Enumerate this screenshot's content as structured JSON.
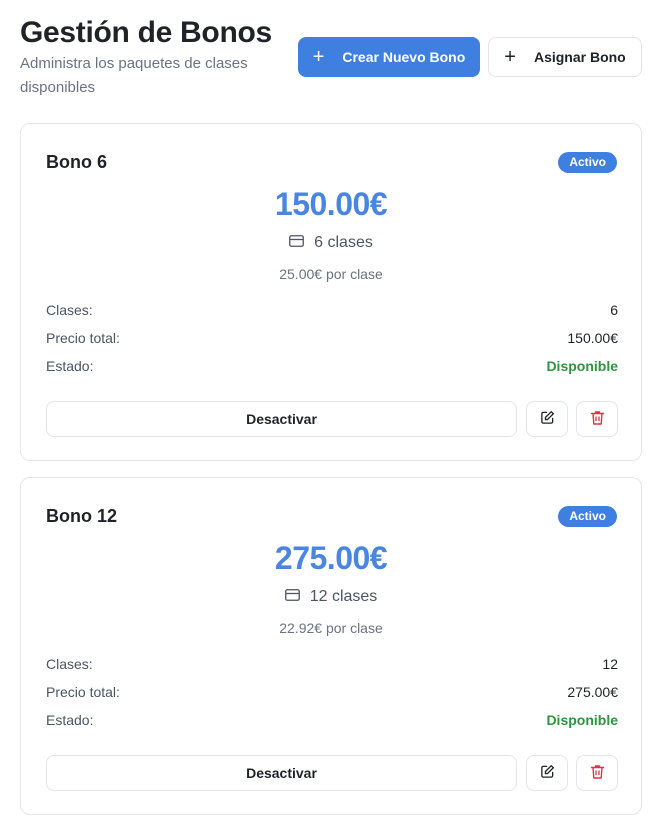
{
  "header": {
    "title": "Gestión de Bonos",
    "subtitle": "Administra los paquetes de clases disponibles",
    "create_label": "Crear Nuevo Bono",
    "assign_label": "Asignar Bono"
  },
  "labels": {
    "classes": "Clases:",
    "total_price": "Precio total:",
    "status": "Estado:",
    "deactivate": "Desactivar"
  },
  "bonos": [
    {
      "name": "Bono 6",
      "badge": "Activo",
      "price": "150.00€",
      "classes_text": "6 clases",
      "per_class": "25.00€ por clase",
      "classes_value": "6",
      "total_value": "150.00€",
      "status_value": "Disponible"
    },
    {
      "name": "Bono 12",
      "badge": "Activo",
      "price": "275.00€",
      "classes_text": "12 clases",
      "per_class": "22.92€ por clase",
      "classes_value": "12",
      "total_value": "275.00€",
      "status_value": "Disponible"
    }
  ],
  "colors": {
    "accent": "#3f7fe0",
    "price": "#4a86e0",
    "available": "#2e9440",
    "delete": "#dc3545"
  },
  "icons": [
    "plus-icon",
    "card-icon",
    "edit-icon",
    "trash-icon"
  ]
}
